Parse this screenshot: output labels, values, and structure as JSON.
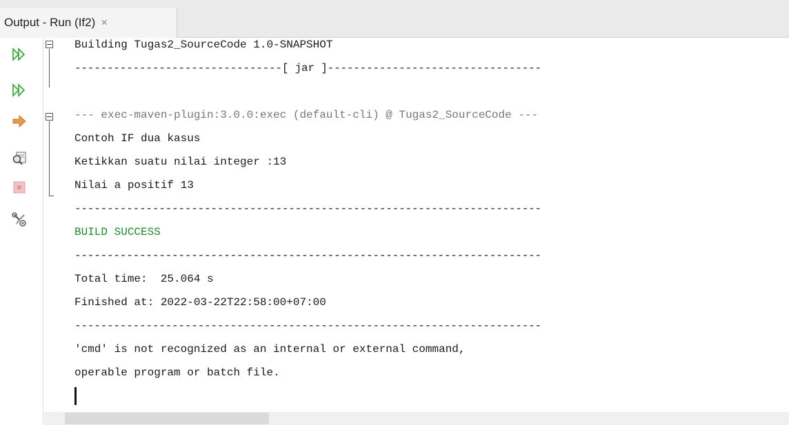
{
  "tab": {
    "title": "Output - Run (If2)",
    "close_glyph": "×"
  },
  "toolbar": [
    {
      "name": "rerun-icon",
      "tooltip": "Re-run"
    },
    {
      "name": "rerun-goals-icon",
      "tooltip": "Re-run with different parameters"
    },
    {
      "name": "forward-arrow-icon",
      "tooltip": "Resume"
    },
    {
      "name": "inspect-icon",
      "tooltip": "Show build overview"
    },
    {
      "name": "stop-icon",
      "tooltip": "Stop"
    },
    {
      "name": "settings-icon",
      "tooltip": "Maven settings"
    }
  ],
  "console": {
    "lines": [
      {
        "text": "Building Tugas2_SourceCode 1.0-SNAPSHOT",
        "style": "normal"
      },
      {
        "text": "--------------------------------[ jar ]---------------------------------",
        "style": "normal"
      },
      {
        "text": "",
        "style": "normal"
      },
      {
        "text": "--- exec-maven-plugin:3.0.0:exec (default-cli) @ Tugas2_SourceCode ---",
        "style": "gray"
      },
      {
        "text": "Contoh IF dua kasus",
        "style": "normal"
      },
      {
        "text": "Ketikkan suatu nilai integer :13",
        "style": "normal"
      },
      {
        "text": "Nilai a positif 13",
        "style": "normal"
      },
      {
        "text": "------------------------------------------------------------------------",
        "style": "normal"
      },
      {
        "text": "BUILD SUCCESS",
        "style": "green"
      },
      {
        "text": "------------------------------------------------------------------------",
        "style": "normal"
      },
      {
        "text": "Total time:  25.064 s",
        "style": "normal"
      },
      {
        "text": "Finished at: 2022-03-22T22:58:00+07:00",
        "style": "normal"
      },
      {
        "text": "------------------------------------------------------------------------",
        "style": "normal"
      },
      {
        "text": "'cmd' is not recognized as an internal or external command,",
        "style": "normal"
      },
      {
        "text": "operable program or batch file.",
        "style": "normal"
      }
    ]
  },
  "colors": {
    "success_green": "#1e8a2a",
    "plugin_gray": "#777777",
    "rerun_green": "#3aa33a",
    "arrow_orange": "#e08a2e",
    "stop_red": "#d66a6a"
  }
}
